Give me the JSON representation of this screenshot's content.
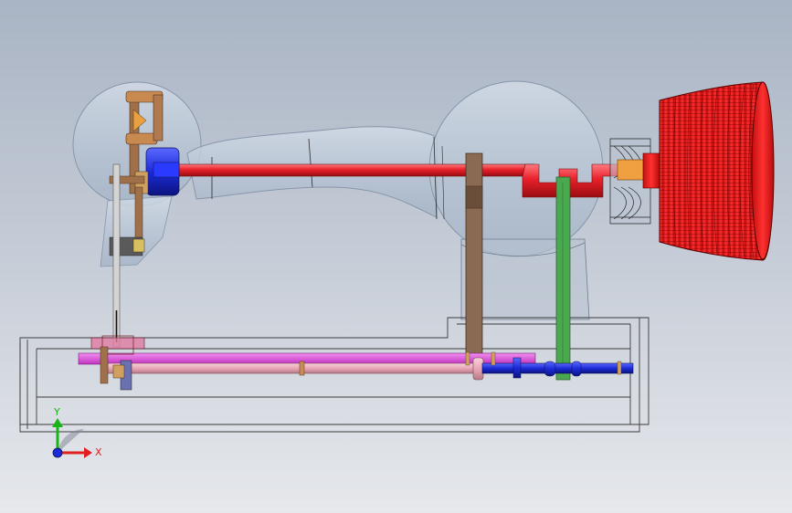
{
  "view": {
    "background_top": "#a9b4c4",
    "background_bottom": "#e6e8ec"
  },
  "colors": {
    "upper_shaft": "#e8202a",
    "handwheel": "#e41b1b",
    "motor_block": "#1c2bd6",
    "lower_shaft_blue": "#2632d8",
    "lower_shaft_pink": "#e8a7b4",
    "magenta_rod": "#e354e0",
    "belt_green": "#4aa84f",
    "connecting_rod_brown": "#8a6a52",
    "bracket_bronze": "#a0704a",
    "needle_bar": "#c7c7c7",
    "housing_glass": "#b9c7d8"
  },
  "triad": {
    "y_label": "Y",
    "x_label": "X",
    "y_color": "#18b418",
    "x_color": "#e02020",
    "z_color": "#1c2bd6"
  }
}
